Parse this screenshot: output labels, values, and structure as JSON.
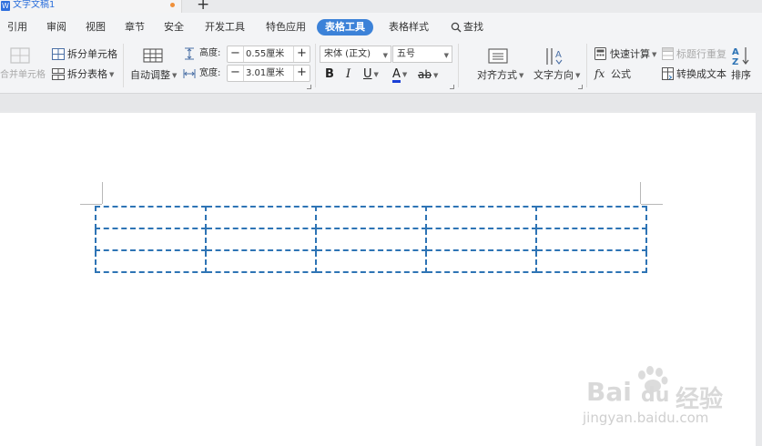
{
  "window": {
    "doc_title": "文字文稿1",
    "doc_icon_letter": "W",
    "new_tab_symbol": "+"
  },
  "menu": {
    "tabs": [
      "引用",
      "审阅",
      "视图",
      "章节",
      "安全",
      "开发工具",
      "特色应用",
      "表格工具",
      "表格样式"
    ],
    "active_tab": "表格工具",
    "search_label": "查找"
  },
  "ribbon": {
    "merge_cells": "合并单元格",
    "split_cells": "拆分单元格",
    "split_table": "拆分表格",
    "auto_fit": "自动调整",
    "height_label": "高度:",
    "height_value": "0.55厘米",
    "width_label": "宽度:",
    "width_value": "3.01厘米",
    "font_name": "宋体 (正文)",
    "font_size": "五号",
    "bold": "B",
    "italic": "I",
    "underline": "U",
    "font_color": "A",
    "highlight": "ab",
    "align": "对齐方式",
    "text_direction": "文字方向",
    "quick_calc": "快速计算",
    "repeat_header": "标题行重复",
    "formula_icon": "fx",
    "formula": "公式",
    "convert_text": "转换成文本",
    "sort": "排序",
    "minus": "−",
    "plus": "+"
  },
  "document": {
    "table": {
      "rows": 3,
      "columns": 5,
      "border_style": "dash-dot",
      "border_color": "#2e74b5"
    }
  },
  "watermark": {
    "brand": "Bai",
    "brand2": "du",
    "suffix": "经验",
    "url": "jingyan.baidu.com"
  },
  "colors": {
    "accent": "#3c82d8",
    "doc_title": "#2a6edb",
    "font_color_bar": "#1a3fd6",
    "table_border": "#2e74b5"
  }
}
